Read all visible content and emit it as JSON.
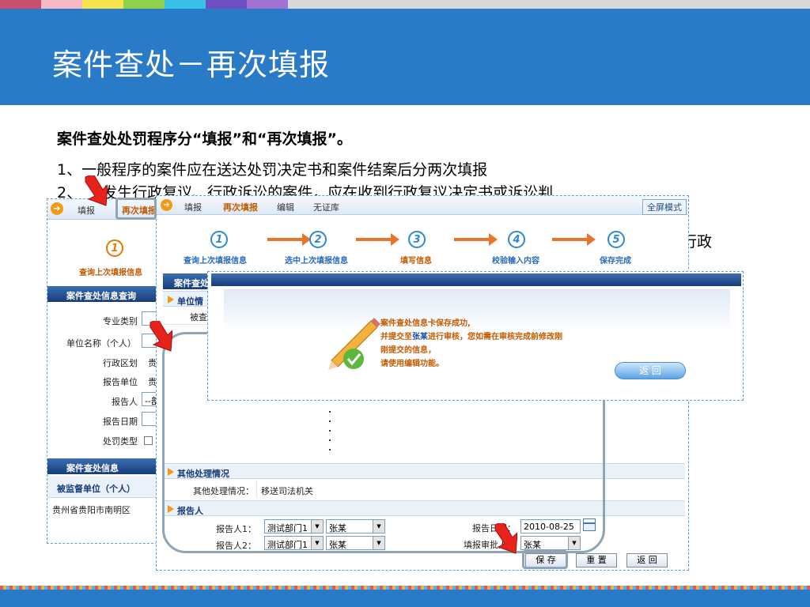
{
  "slide": {
    "title": "案件查处－再次填报",
    "heading": "案件查处处罚程序分“填报”和“再次填报”。",
    "line1": "1、一般程序的案件应在送达处罚决定书和案件结案后分两次填报",
    "line2_prefix": "2、",
    "line2_rest": "发生行政复议、行政诉讼的案件，应在收到行政复议决定书或诉讼判",
    "line3_tail": "行政"
  },
  "back_window": {
    "nav": {
      "fill": "填报",
      "refill": "再次填报"
    },
    "step1_label": "查询上次填报信息",
    "query_section": "案件查处信息查询",
    "fields": [
      "专业类别",
      "单位名称（个人）",
      "行政区划",
      "报告单位",
      "报告人",
      "报告日期",
      "处罚类型"
    ],
    "value_region_partial": "贵",
    "value_unit_partial": "贵",
    "value_reporter_partial": "--部",
    "info_section": "案件查处信息",
    "supervised_header": "被监督单位（个人）",
    "supervised_value": "贵州省贵阳市南明区"
  },
  "front_window": {
    "nav": {
      "fill": "填报",
      "refill": "再次填报",
      "edit": "编辑",
      "nolicense": "无证库",
      "fullscreen": "全屏模式"
    },
    "steps": [
      {
        "num": "1",
        "label": "查询上次填报信息"
      },
      {
        "num": "2",
        "label": "选中上次填报信息"
      },
      {
        "num": "3",
        "label": "填写信息"
      },
      {
        "num": "4",
        "label": "校验输入内容"
      },
      {
        "num": "5",
        "label": "保存完成"
      }
    ],
    "case_section_partial": "案件查处",
    "unit_sub_partial": "单位情",
    "checked_partial": "被查",
    "other_section": "其他处理情况",
    "other_label": "其他处理情况：",
    "other_value": "移送司法机关",
    "reporter_section": "报告人",
    "reporter1_label": "报告人1：",
    "reporter2_label": "报告人2：",
    "dept1": "测试部门1",
    "dept2": "测试部门1",
    "person1": "张某",
    "person2": "张某",
    "report_date_label": "报告日期：",
    "report_date": "2010-08-25",
    "approver_label": "填报审批人：",
    "approver": "张某",
    "buttons": {
      "save": "保  存",
      "reset": "重  置",
      "back": "返  回"
    }
  },
  "dialog": {
    "msg1": "案件查处信息卡保存成功,",
    "msg2_pre": "并提交至",
    "msg2_name": "张某",
    "msg2_post": "进行审核，您如需在审核完成前修改刚",
    "msg3": "刚提交的信息，",
    "msg4": "请使用编辑功能。",
    "back_button": "返  回"
  }
}
